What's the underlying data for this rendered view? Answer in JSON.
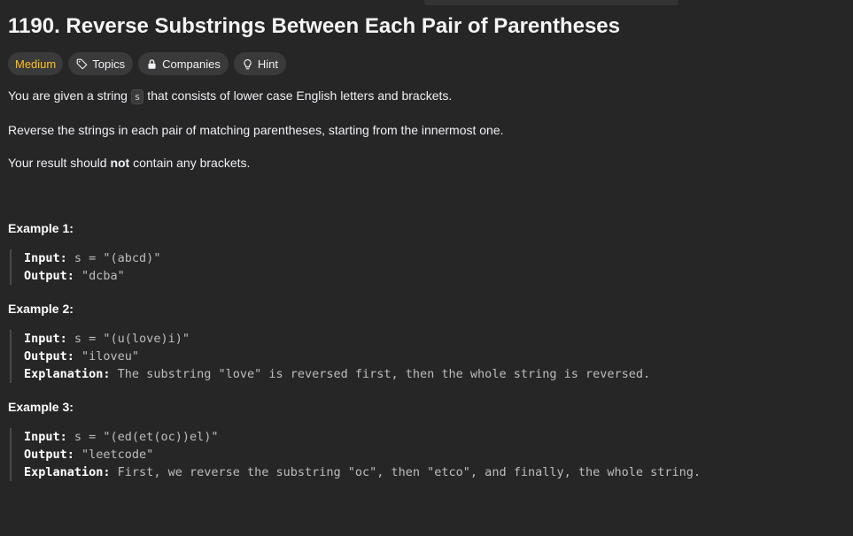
{
  "problem": {
    "title": "1190. Reverse Substrings Between Each Pair of Parentheses",
    "difficulty": "Medium",
    "tags": [
      {
        "label": "Topics",
        "icon": "tag-icon"
      },
      {
        "label": "Companies",
        "icon": "lock-icon"
      },
      {
        "label": "Hint",
        "icon": "lightbulb-icon"
      }
    ]
  },
  "description": {
    "p1_before": "You are given a string ",
    "p1_code": "s",
    "p1_after": " that consists of lower case English letters and brackets.",
    "p2": "Reverse the strings in each pair of matching parentheses, starting from the innermost one.",
    "p3_before": "Your result should ",
    "p3_bold": "not",
    "p3_after": " contain any brackets."
  },
  "examples": [
    {
      "title": "Example 1:",
      "input_label": "Input:",
      "input_value": " s = \"(abcd)\"",
      "output_label": "Output:",
      "output_value": " \"dcba\""
    },
    {
      "title": "Example 2:",
      "input_label": "Input:",
      "input_value": " s = \"(u(love)i)\"",
      "output_label": "Output:",
      "output_value": " \"iloveu\"",
      "explanation_label": "Explanation:",
      "explanation_value": " The substring \"love\" is reversed first, then the whole string is reversed."
    },
    {
      "title": "Example 3:",
      "input_label": "Input:",
      "input_value": " s = \"(ed(et(oc))el)\"",
      "output_label": "Output:",
      "output_value": " \"leetcode\"",
      "explanation_label": "Explanation:",
      "explanation_value": " First, we reverse the substring \"oc\", then \"etco\", and finally, the whole string."
    }
  ],
  "colors": {
    "background": "#262626",
    "difficulty_medium": "#ffc01e",
    "tag_background": "#3a3a3a"
  }
}
